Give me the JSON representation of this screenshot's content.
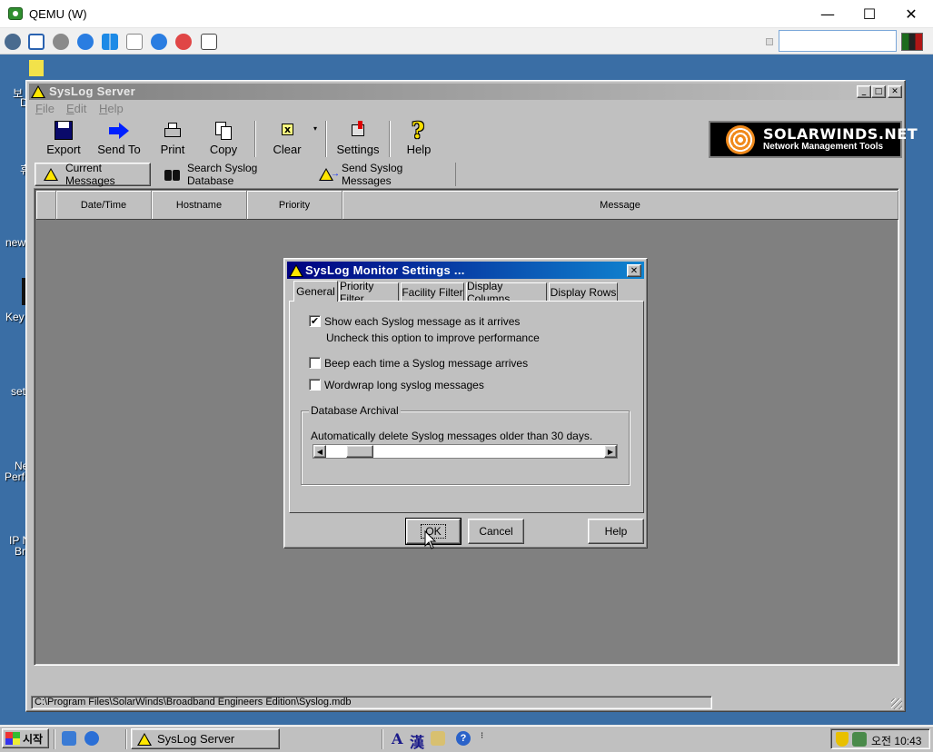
{
  "host": {
    "title": "QEMU (W)",
    "controls": {
      "minimize": "—",
      "maximize": "☐",
      "close": "✕"
    },
    "search_value": ""
  },
  "desktop": {
    "icon_labels": [
      "보",
      "D",
      "휴",
      "new",
      "Key",
      "set",
      "Ne",
      "Perf",
      "IP N",
      "Br"
    ]
  },
  "syslog": {
    "title": "SysLog Server",
    "window_buttons": {
      "minimize": "_",
      "maximize": "□",
      "close": "✕"
    },
    "menu": [
      {
        "label": "File",
        "key": "F",
        "rest": "ile"
      },
      {
        "label": "Edit",
        "key": "E",
        "rest": "dit"
      },
      {
        "label": "Help",
        "key": "H",
        "rest": "elp"
      }
    ],
    "toolbar": {
      "export": "Export",
      "send_to": "Send To",
      "print": "Print",
      "copy": "Copy",
      "clear": "Clear",
      "settings": "Settings",
      "help": "Help"
    },
    "logo": {
      "brand": "SOLARWINDS.NET",
      "tagline": "Network Management Tools"
    },
    "tabs": {
      "current": "Current Messages",
      "search": "Search Syslog Database",
      "send": "Send Syslog Messages"
    },
    "columns": [
      "Date/Time",
      "Hostname",
      "Priority",
      "Message"
    ],
    "status_path": "C:\\Program Files\\SolarWinds\\Broadband Engineers Edition\\Syslog.mdb"
  },
  "dialog": {
    "title": "SysLog Monitor Settings ...",
    "close": "✕",
    "tabs": [
      "General",
      "Priority Filter",
      "Facility Filter",
      "Display Columns",
      "Display Rows"
    ],
    "options": {
      "show_each": {
        "label": "Show each Syslog message as it arrives",
        "checked": "✔"
      },
      "show_each_hint": "Uncheck this option to improve performance",
      "beep": {
        "label": "Beep each time a Syslog message arrives",
        "checked": ""
      },
      "wordwrap": {
        "label": "Wordwrap long syslog messages",
        "checked": ""
      }
    },
    "archival": {
      "legend": "Database Archival",
      "description": "Automatically delete Syslog messages older than 30 days.",
      "days": 30,
      "left_arrow": "◀",
      "right_arrow": "▶"
    },
    "buttons": {
      "ok": "OK",
      "cancel": "Cancel",
      "help": "Help"
    }
  },
  "taskbar": {
    "start": "시작",
    "task": "SysLog Server",
    "ime_a": "A",
    "ime_han": "漢",
    "clock": "오전 10:43"
  }
}
